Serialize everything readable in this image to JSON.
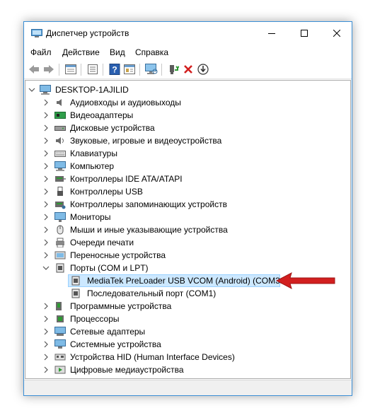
{
  "window": {
    "title": "Диспетчер устройств"
  },
  "menu": [
    "Файл",
    "Действие",
    "Вид",
    "Справка"
  ],
  "toolbar": {
    "icons": [
      "back-icon",
      "forward-icon",
      "properties-grid-icon",
      "show-list-icon",
      "help-icon",
      "resource-view-icon",
      "monitor-scan-icon",
      "update-driver-icon",
      "uninstall-icon",
      "download-icon"
    ]
  },
  "tree": {
    "root": "DESKTOP-1AJILID",
    "items": [
      "Аудиовходы и аудиовыходы",
      "Видеоадаптеры",
      "Дисковые устройства",
      "Звуковые, игровые и видеоустройства",
      "Клавиатуры",
      "Компьютер",
      "Контроллеры IDE ATA/ATAPI",
      "Контроллеры USB",
      "Контроллеры запоминающих устройств",
      "Мониторы",
      "Мыши и иные указывающие устройства",
      "Очереди печати",
      "Переносные устройства",
      "Порты (COM и LPT)",
      "MediaTek PreLoader USB VCOM (Android) (COM31)",
      "Последовательный порт (COM1)",
      "Программные устройства",
      "Процессоры",
      "Сетевые адаптеры",
      "Системные устройства",
      "Устройства HID (Human Interface Devices)",
      "Цифровые медиаустройства"
    ]
  },
  "colors": {
    "selection": "#cce8ff",
    "arrow": "#d21f1f",
    "accent": "#3b8fd6"
  }
}
